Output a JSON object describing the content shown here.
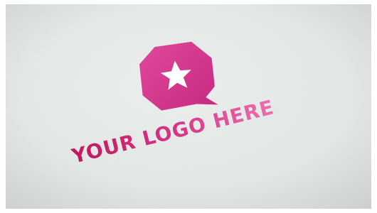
{
  "image": {
    "logo_text": "YOUR LOGO HERE",
    "icon": "speech-bubble-star-icon",
    "colors": {
      "paper": "#e8ebe9",
      "magenta_dark": "#c2185b",
      "magenta_mid": "#d63384",
      "pink_light": "#e95ba6",
      "star": "#ffffff"
    }
  }
}
